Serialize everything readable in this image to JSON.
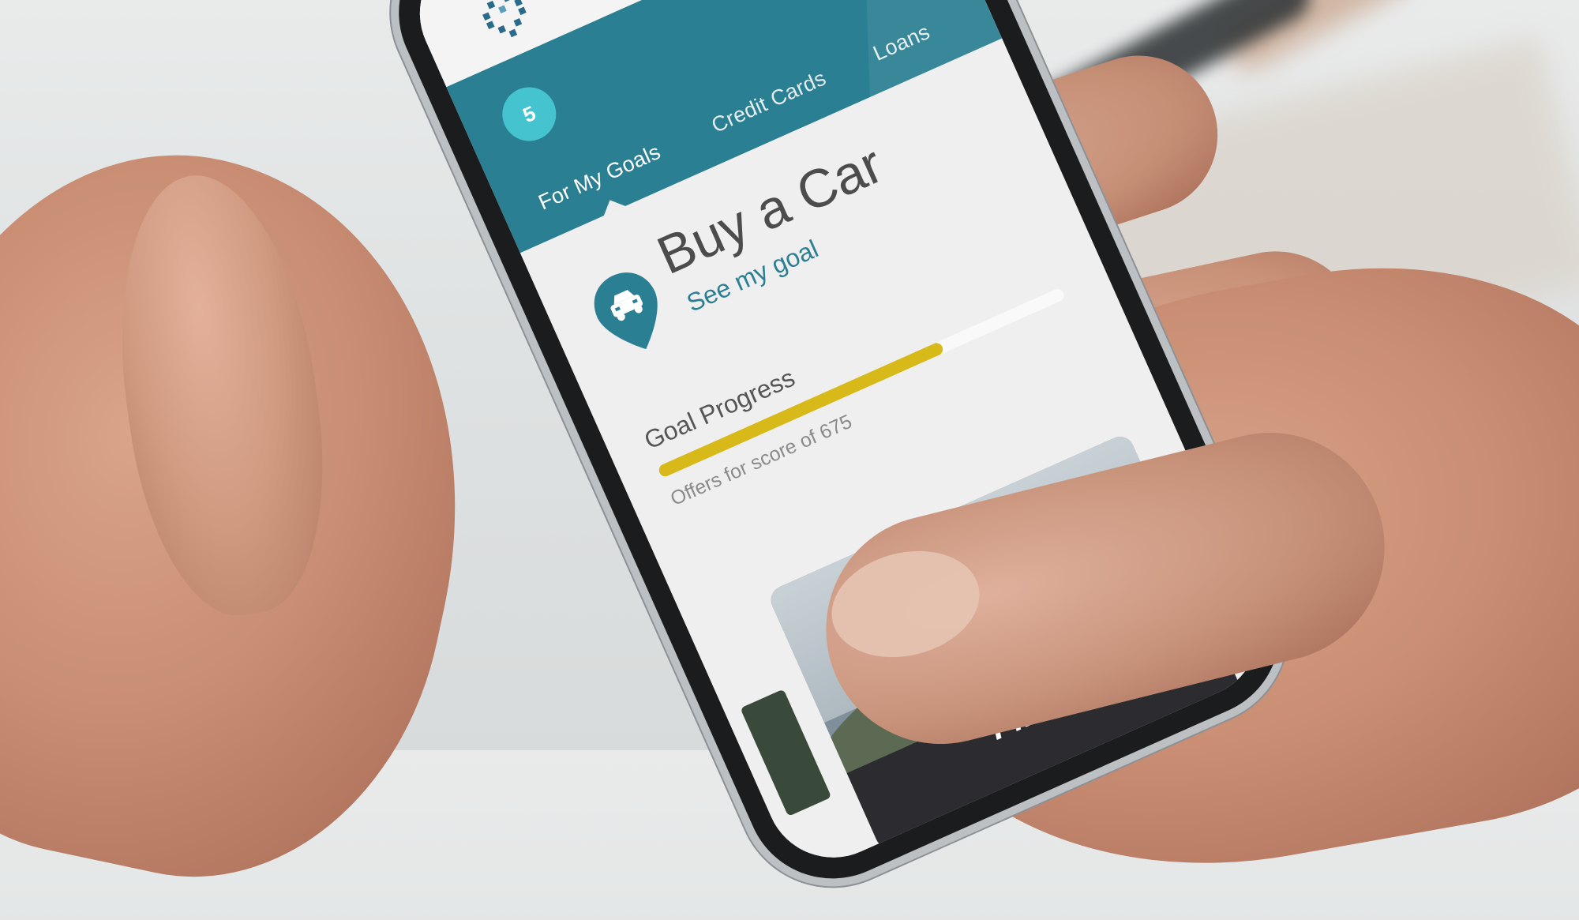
{
  "app": {
    "tab_badge": "5",
    "tabs": [
      {
        "label": "For My Goals",
        "selected": true
      },
      {
        "label": "Credit Cards",
        "selected": false
      },
      {
        "label": "Loans",
        "selected": false
      }
    ]
  },
  "goal": {
    "title": "Buy a Car",
    "link": "See my goal",
    "progress_label": "Goal Progress",
    "progress_fraction": 0.7,
    "progress_sub": "Offers for score of 675",
    "icon": "car-pin-icon"
  },
  "card": {
    "text": "Financed"
  },
  "colors": {
    "brand_teal": "#2a7f92",
    "badge_cyan": "#45c4cf",
    "progress_yellow": "#d7b91a"
  }
}
